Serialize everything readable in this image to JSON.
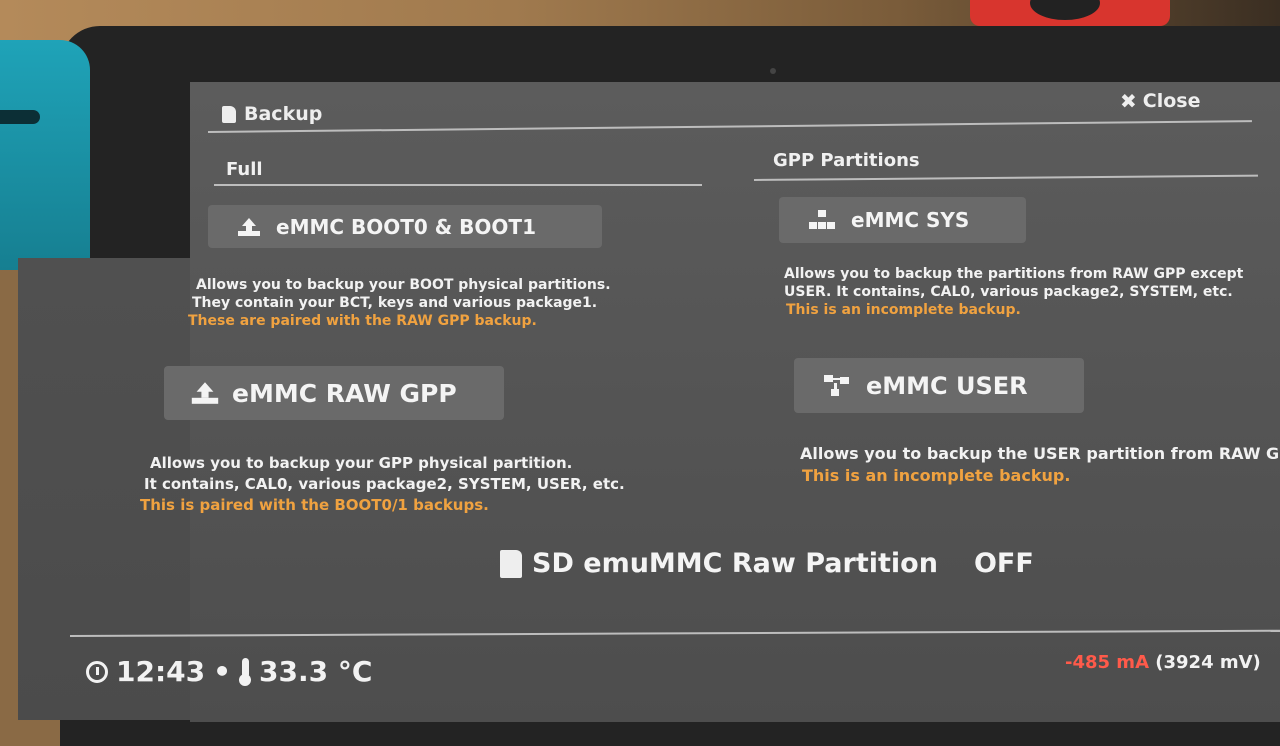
{
  "header": {
    "title": "Backup",
    "close_label": "Close"
  },
  "sections": {
    "full": "Full",
    "gpp": "GPP Partitions"
  },
  "buttons": {
    "boot": "eMMC BOOT0 & BOOT1",
    "raw_gpp": "eMMC RAW GPP",
    "sys": "eMMC SYS",
    "user": "eMMC USER"
  },
  "desc": {
    "boot": {
      "line1": "Allows you to backup your BOOT physical partitions.",
      "line2": "They contain your BCT, keys and various package1.",
      "warn": "These are paired with the RAW GPP backup."
    },
    "raw_gpp": {
      "line1": "Allows you to backup your GPP physical partition.",
      "line2": "It contains, CAL0, various package2, SYSTEM, USER, etc.",
      "warn": "This is paired with the BOOT0/1 backups."
    },
    "sys": {
      "line1": "Allows you to backup the partitions from RAW GPP except",
      "line2": "USER. It contains, CAL0, various package2, SYSTEM, etc.",
      "warn": "This is an incomplete backup."
    },
    "user": {
      "line1": "Allows you to backup the USER partition from RAW G",
      "warn": "This is an incomplete backup."
    }
  },
  "toggle": {
    "label": "SD emuMMC Raw Partition",
    "value": "OFF"
  },
  "footer": {
    "time": "12:43",
    "separator": "•",
    "temp": "33.3 °C",
    "current": "-485 mA",
    "voltage": "(3924 mV)"
  },
  "colors": {
    "warning": "#f0a240",
    "current": "#ff5a4a",
    "button_bg": "#6a6a6a"
  }
}
